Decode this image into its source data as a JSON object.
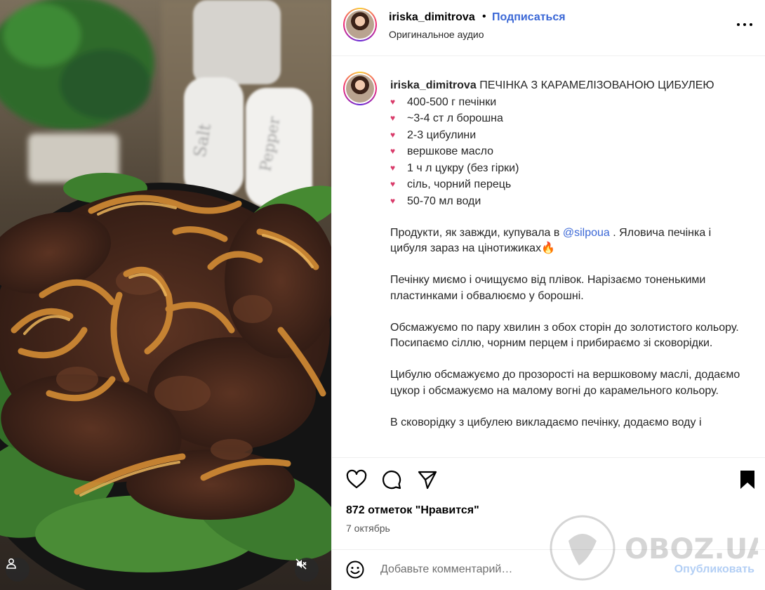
{
  "post": {
    "username": "iriska_dimitrova",
    "dot": "•",
    "follow_label": "Подписаться",
    "audio_label": "Оригинальное аудио",
    "more_icon": "more-horizontal-icon"
  },
  "caption": {
    "username": "iriska_dimitrova",
    "title": "ПЕЧІНКА З КАРАМЕЛІЗОВАНОЮ ЦИБУЛЕЮ",
    "bullet": "♥",
    "ingredients": [
      "400-500 г печінки",
      "~3-4 ст л борошна",
      "2-3 цибулини",
      "вершкове масло",
      "1 ч л цукру (без гірки)",
      "сіль, чорний перець",
      "50-70 мл води"
    ],
    "p1_before": "Продукти, як завжди, купувала в ",
    "p1_mention": "@silpoua",
    "p1_after": " . Яловича печінка і цибуля зараз на цінотижиках🔥",
    "p2": "Печінку миємо і очищуємо від плівок. Нарізаємо тоненькими пластинками і обвалюємо у борошні.",
    "p3": "Обсмажуємо по пару хвилин з обох сторін до золотистого кольору. Посипаємо сіллю, чорним перцем і прибираємо зі сковорідки.",
    "p4": "Цибулю обсмажуємо до прозорості на вершковому маслі, додаємо цукор і обсмажуємо на малому вогні до карамельного кольору.",
    "p5": "В сковорідку з цибулею викладаємо печінку, додаємо воду і"
  },
  "actions": {
    "icons": [
      "heart-icon",
      "comment-icon",
      "share-icon",
      "bookmark-icon"
    ]
  },
  "likes_text": "872 отметок \"Нравится\"",
  "date_text": "7 октябрь",
  "comment": {
    "placeholder": "Добавьте комментарий…",
    "publish_label": "Опубликовать"
  },
  "media": {
    "salt_label": "Salt",
    "pepper_label": "Pepper"
  },
  "watermark_text": "OBOZ.UA",
  "colors": {
    "link": "#3a67d6",
    "publish_disabled": "#b3cff5",
    "bullet_heart": "#d93b6a"
  }
}
